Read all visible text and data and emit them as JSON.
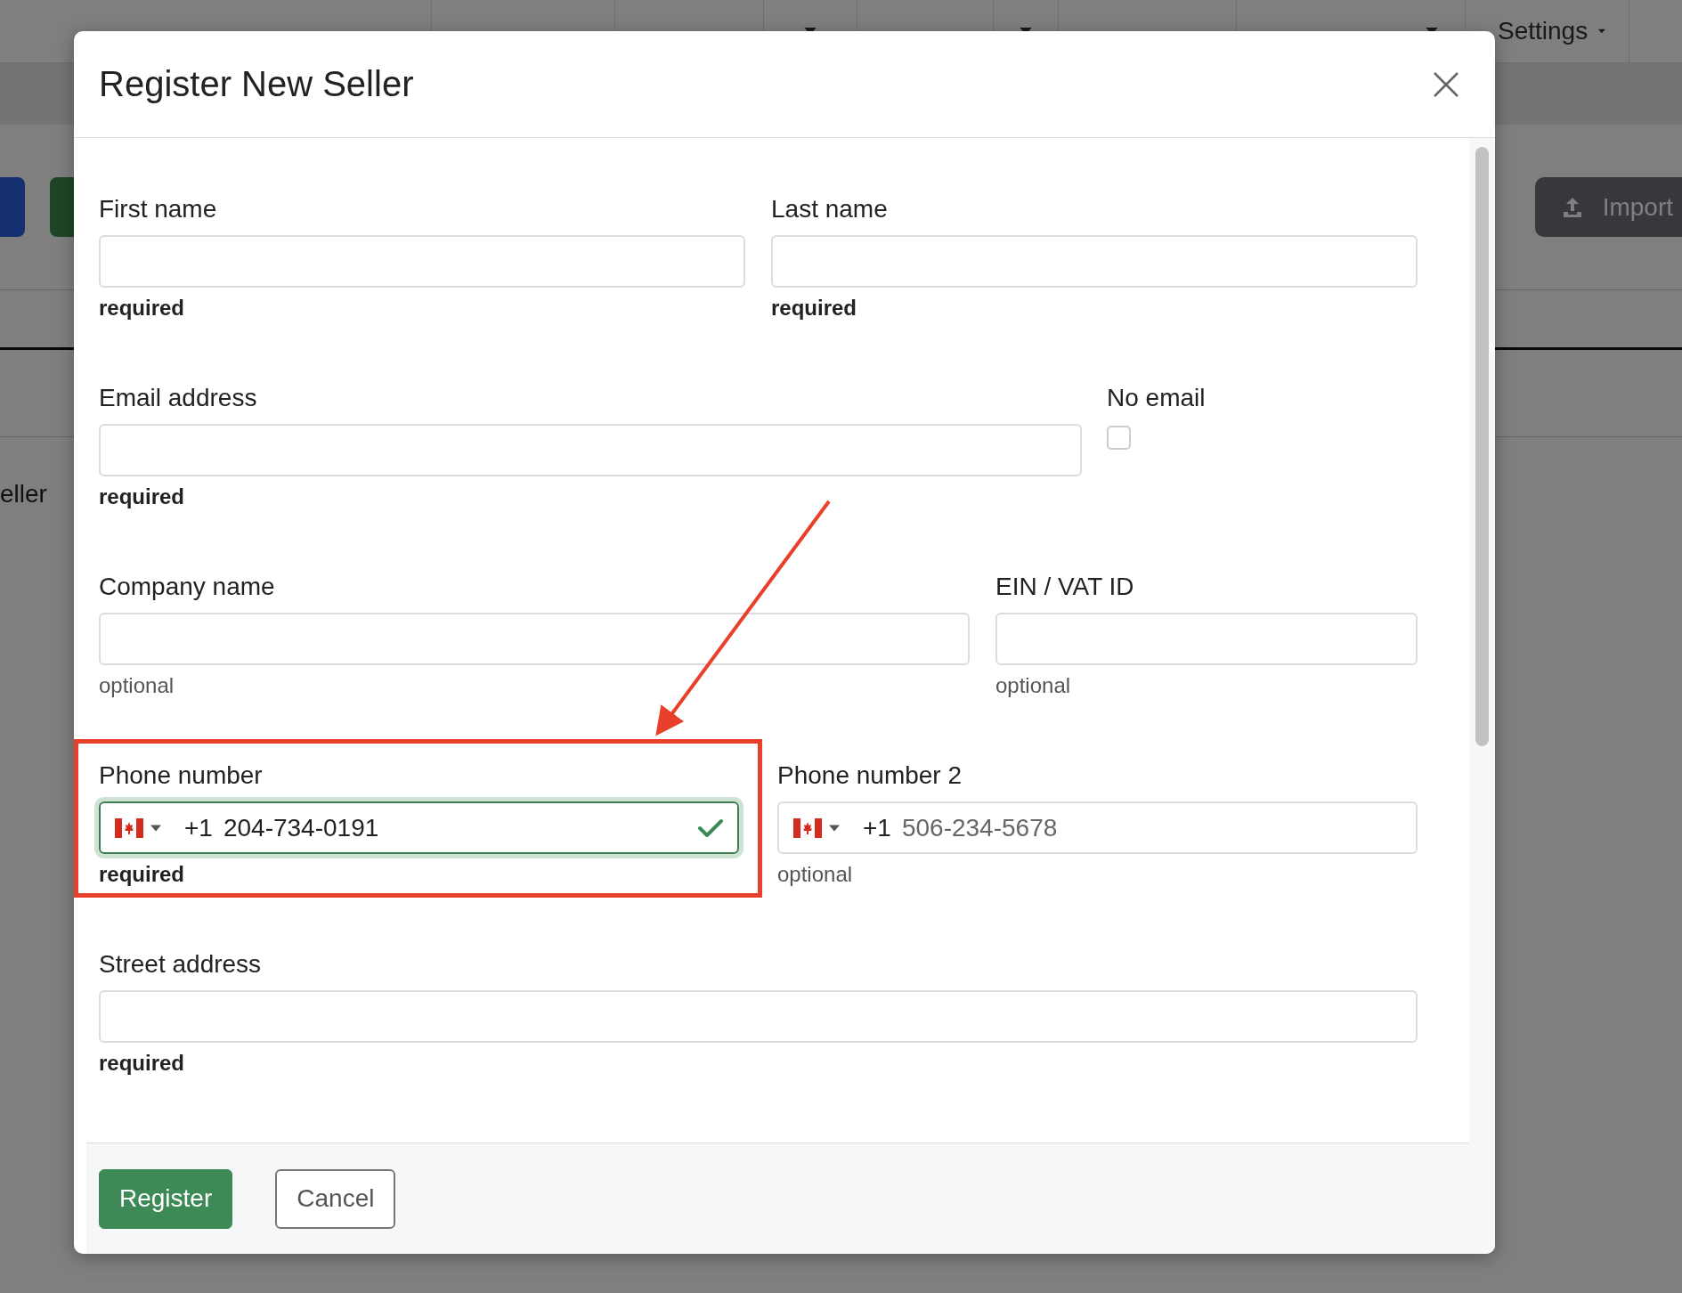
{
  "nav": [
    {
      "kind": "plain"
    },
    {
      "kind": "split"
    },
    {
      "kind": "split"
    },
    {
      "kind": "plain"
    },
    {
      "kind": "dropdown"
    },
    {
      "label": "Settings",
      "kind": "dropdown"
    }
  ],
  "toolbar": {
    "buttons": [
      {
        "kind": "primary"
      },
      {
        "kind": "success"
      }
    ],
    "import_button": "Import"
  },
  "page_text": "eller",
  "modal": {
    "title": "Register New Seller",
    "rows": [
      {
        "kind": "pair",
        "fields": [
          {
            "kind": "text",
            "label": "First name",
            "hint": "required",
            "required": true
          },
          {
            "kind": "text",
            "label": "Last name",
            "hint": "required",
            "required": true
          }
        ]
      },
      {
        "kind": "main-check",
        "fields": [
          {
            "kind": "text",
            "label": "Email address",
            "hint": "required",
            "required": true
          },
          {
            "kind": "checkbox",
            "label": "No email",
            "checked": false
          }
        ]
      },
      {
        "kind": "main-side",
        "fields": [
          {
            "kind": "text",
            "label": "Company name",
            "hint": "optional",
            "required": false
          },
          {
            "kind": "text",
            "label": "EIN / VAT ID",
            "hint": "optional",
            "required": false
          }
        ]
      },
      {
        "kind": "phones",
        "fields": [
          {
            "kind": "phone",
            "label": "Phone number",
            "dial_code": "+1",
            "value": "204-734-0191",
            "valid": true,
            "highlighted": true,
            "hint": "required",
            "required": true
          },
          {
            "kind": "phone",
            "label": "Phone number 2",
            "dial_code": "+1",
            "placeholder": "506-234-5678",
            "valid": false,
            "hint": "optional",
            "required": false
          }
        ]
      },
      {
        "kind": "single",
        "fields": [
          {
            "kind": "text",
            "label": "Street address",
            "hint": "required",
            "required": true
          }
        ]
      }
    ],
    "buttons": [
      {
        "label": "Register",
        "kind": "primary"
      },
      {
        "label": "Cancel",
        "kind": "secondary"
      }
    ]
  }
}
